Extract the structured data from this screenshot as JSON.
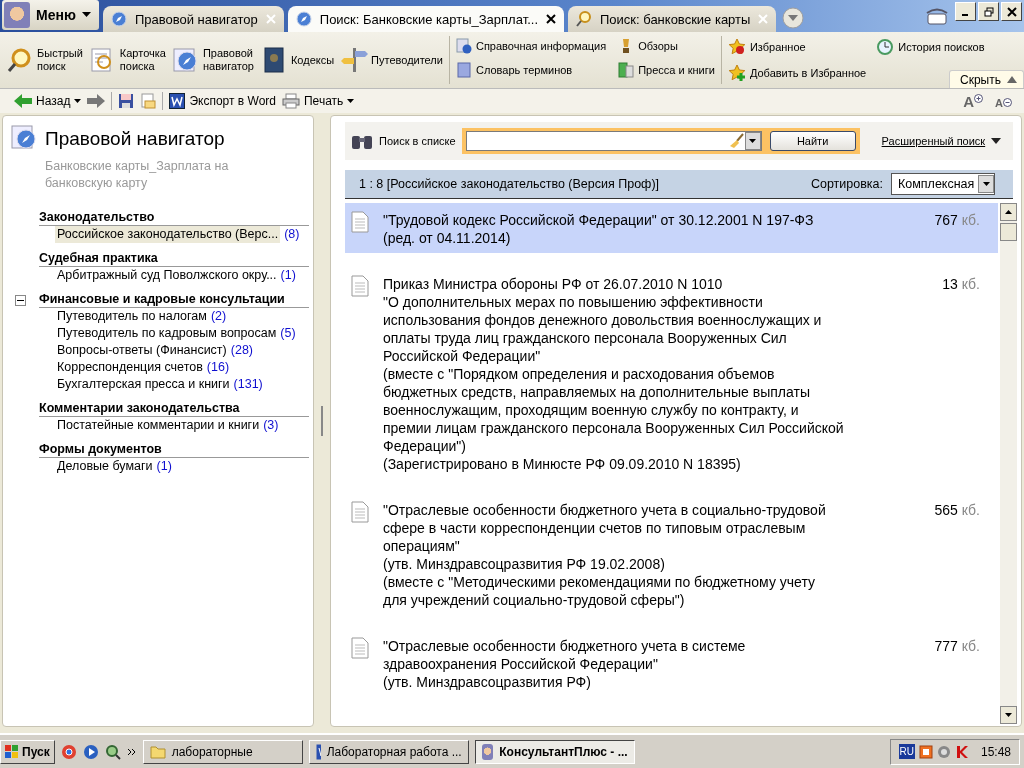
{
  "menu": {
    "label": "Меню"
  },
  "tabs": [
    {
      "label": "Правовой навигатор",
      "selected": false
    },
    {
      "label": "Поиск: Банковские карты_Зарплат...",
      "selected": true
    },
    {
      "label": "Поиск: банковские карты",
      "selected": false
    }
  ],
  "ribbon": {
    "large": [
      {
        "lines": [
          "Быстрый",
          "поиск"
        ]
      },
      {
        "lines": [
          "Карточка",
          "поиска"
        ]
      },
      {
        "lines": [
          "Правовой",
          "навигатор"
        ]
      },
      {
        "lines": [
          "Кодексы"
        ]
      },
      {
        "lines": [
          "Путеводители"
        ]
      }
    ],
    "middle": [
      "Справочная информация",
      "Обзоры",
      "Словарь терминов",
      "Пресса и книги"
    ],
    "right": [
      "Избранное",
      "История поисков",
      "Добавить в Избранное"
    ],
    "hide": "Скрыть"
  },
  "navbar": {
    "back": "Назад",
    "export": "Экспорт в Word",
    "print": "Печать",
    "font_larger": "A",
    "font_smaller": "A"
  },
  "navigator": {
    "title": "Правовой навигатор",
    "subtitle": "Банковские карты_Зарплата на банковскую карту",
    "sections": [
      {
        "heading": "Законодательство",
        "items": [
          {
            "label": "Российское законодательство (Верс...",
            "count": "(8)",
            "selected": true
          }
        ]
      },
      {
        "heading": "Судебная практика",
        "items": [
          {
            "label": "Арбитражный суд Поволжского окру...",
            "count": "(1)",
            "selected": false
          }
        ]
      },
      {
        "heading": "Финансовые и кадровые консультации",
        "expanded": true,
        "items": [
          {
            "label": "Путеводитель по налогам",
            "count": "(2)",
            "selected": false
          },
          {
            "label": "Путеводитель по кадровым вопросам",
            "count": "(5)",
            "selected": false
          },
          {
            "label": "Вопросы-ответы (Финансист)",
            "count": "(28)",
            "selected": false
          },
          {
            "label": "Корреспонденция счетов",
            "count": "(16)",
            "selected": false
          },
          {
            "label": "Бухгалтерская пресса и книги",
            "count": "(131)",
            "selected": false
          }
        ]
      },
      {
        "heading": "Комментарии законодательства",
        "items": [
          {
            "label": "Постатейные комментарии и книги",
            "count": "(3)",
            "selected": false
          }
        ]
      },
      {
        "heading": "Формы документов",
        "items": [
          {
            "label": "Деловые бумаги",
            "count": "(1)",
            "selected": false
          }
        ]
      }
    ]
  },
  "search": {
    "label": "Поиск в списке",
    "button": "Найти",
    "advanced": "Расширенный поиск"
  },
  "results": {
    "summary": "1 : 8 [Российское законодательство (Версия Проф)]",
    "sort_label": "Сортировка:",
    "sort_value": "Комплексная",
    "documents": [
      {
        "lines": [
          "\"Трудовой кодекс Российской Федерации\" от 30.12.2001 N 197-ФЗ",
          "(ред. от 04.11.2014)"
        ],
        "size": "767",
        "unit": "кб.",
        "selected": true
      },
      {
        "lines": [
          "Приказ Министра обороны РФ от 26.07.2010 N 1010",
          "\"О дополнительных мерах по повышению эффективности",
          "использования фондов денежного довольствия военнослужащих и",
          "оплаты труда лиц гражданского персонала Вооруженных Сил",
          "Российской Федерации\"",
          "(вместе с \"Порядком определения и расходования объемов",
          "бюджетных средств, направляемых на дополнительные выплаты",
          "военнослужащим, проходящим военную службу по контракту, и",
          "премии лицам гражданского персонала Вооруженных Сил Российской",
          "Федерации\")",
          "(Зарегистрировано в Минюсте РФ 09.09.2010 N 18395)"
        ],
        "size": "13",
        "unit": "кб.",
        "selected": false
      },
      {
        "lines": [
          "\"Отраслевые особенности бюджетного учета в социально-трудовой",
          "сфере в части корреспонденции счетов по типовым отраслевым",
          "операциям\"",
          "(утв. Минздравсоцразвития РФ 19.02.2008)",
          "(вместе с \"Методическими рекомендациями по бюджетному учету",
          "для учреждений социально-трудовой сферы\")"
        ],
        "size": "565",
        "unit": "кб.",
        "selected": false
      },
      {
        "lines": [
          "\"Отраслевые особенности бюджетного учета в системе",
          "здравоохранения Российской Федерации\"",
          "(утв. Минздравсоцразвития РФ)"
        ],
        "size": "777",
        "unit": "кб.",
        "selected": false
      }
    ]
  },
  "taskbar": {
    "start": "Пуск",
    "tasks": [
      {
        "label": "лабораторные",
        "selected": false
      },
      {
        "label": "Лабораторная работа ...",
        "selected": false
      },
      {
        "label": "КонсультантПлюс - ...",
        "selected": true
      }
    ],
    "language": "RU",
    "time": "15:48"
  }
}
